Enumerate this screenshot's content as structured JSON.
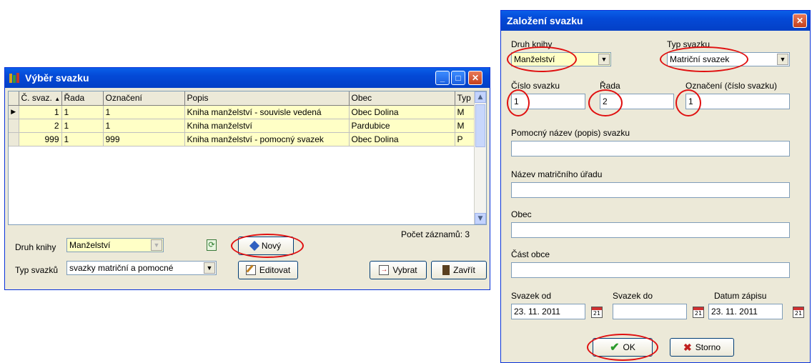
{
  "list_window": {
    "title": "Výběr svazku",
    "columns": [
      "Č. svaz.",
      "Řada",
      "Označení",
      "Popis",
      "Obec",
      "Typ"
    ],
    "rows": [
      [
        "1",
        "1",
        "1",
        "Kniha manželství - souvisle vedená",
        "Obec Dolina",
        "M"
      ],
      [
        "2",
        "1",
        "1",
        "Kniha manželství",
        "Pardubice",
        "M"
      ],
      [
        "999",
        "1",
        "999",
        "Kniha manželství - pomocný svazek",
        "Obec Dolina",
        "P"
      ]
    ],
    "druh_knihy_label": "Druh knihy",
    "druh_knihy_value": "Manželství",
    "typ_svazku_label": "Typ svazků",
    "typ_svazku_value": "svazky matriční a pomocné",
    "pocet_zaznamu": "Počet záznamů: 3",
    "novy_label": "Nový",
    "editovat_label": "Editovat",
    "vybrat_label": "Vybrat",
    "zavrit_label": "Zavřít"
  },
  "dialog": {
    "title": "Založení svazku",
    "druh_knihy_label": "Druh knihy",
    "druh_knihy_value": "Manželství",
    "typ_svazku_label": "Typ svazku",
    "typ_svazku_value": "Matriční svazek",
    "cislo_label": "Číslo svazku",
    "cislo_value": "1",
    "rada_label": "Řada",
    "rada_value": "2",
    "oznaceni_label": "Označení (číslo svazku)",
    "oznaceni_value": "1",
    "pomocny_label": "Pomocný název (popis) svazku",
    "pomocny_value": "",
    "urad_label": "Název matričního úřadu",
    "urad_value": "",
    "obec_label": "Obec",
    "obec_value": "",
    "cast_label": "Část obce",
    "cast_value": "",
    "od_label": "Svazek od",
    "od_value": "23. 11. 2011",
    "do_label": "Svazek do",
    "do_value": "",
    "datum_label": "Datum zápisu",
    "datum_value": "23. 11. 2011",
    "ok_label": "OK",
    "storno_label": "Storno",
    "calendar_day": "21"
  },
  "colors": {
    "title_blue": "#0449d6",
    "highlight_row": "#ffffc6",
    "annotation_red": "#e01010"
  }
}
